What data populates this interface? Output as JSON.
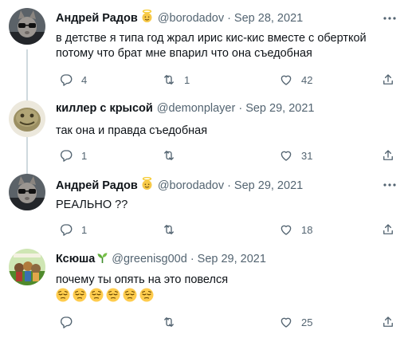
{
  "colors": {
    "text": "#0f1419",
    "muted": "#536471",
    "line": "#cfd9de",
    "green": "#5a9b2e"
  },
  "tweets": [
    {
      "name": "Андрей Радов",
      "handle": "@borodadov",
      "date": "Sep 28, 2021",
      "badge_icon": "angel-emoji-icon",
      "text_lines": [
        "в детстве я типа год жрал ирис кис-кис вместе с оберткой",
        "потому что брат мне впарил что она съедобная"
      ],
      "replies": "4",
      "retweets": "1",
      "likes": "42"
    },
    {
      "name": "киллер с крысой",
      "handle": "@demonplayer",
      "date": "Sep 29, 2021",
      "text_lines": [
        "так она и правда съедобная"
      ],
      "replies": "1",
      "retweets": "",
      "likes": "31"
    },
    {
      "name": "Андрей Радов",
      "handle": "@borodadov",
      "date": "Sep 29, 2021",
      "badge_icon": "angel-emoji-icon",
      "text_lines": [
        "РЕАЛЬНО ??"
      ],
      "replies": "1",
      "retweets": "",
      "likes": "18"
    },
    {
      "name": "Ксюша",
      "handle": "@greenisg00d",
      "date": "Sep 29, 2021",
      "badge_icon": "seedling-icon",
      "text_lines": [
        "почему ты опять на это повелся"
      ],
      "emoji_count": 6,
      "emoji_icon": "pensive-face-icon",
      "replies": "",
      "retweets": "",
      "likes": "25"
    }
  ]
}
